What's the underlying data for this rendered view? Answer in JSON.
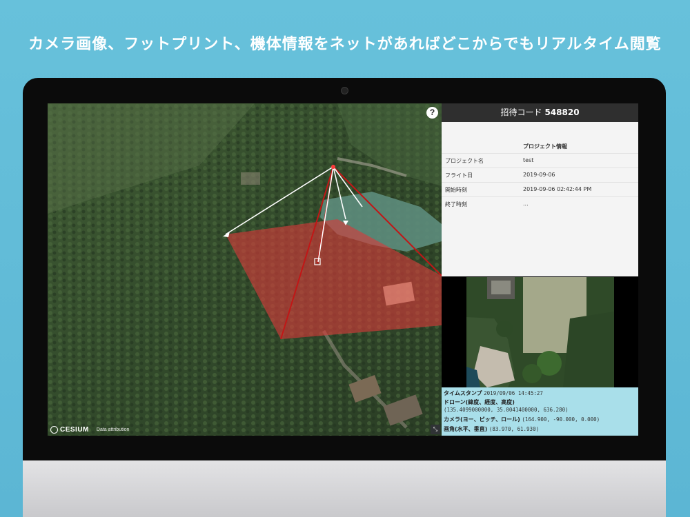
{
  "headline": "カメラ画像、フットプリント、機体情報をネットがあればどこからでもリアルタイム閲覧",
  "panel": {
    "invite_label": "招待コード",
    "invite_code": "548820",
    "info_header": "プロジェクト情報",
    "rows": [
      {
        "label": "プロジェクト名",
        "value": "test"
      },
      {
        "label": "フライト日",
        "value": "2019-09-06"
      },
      {
        "label": "開始時刻",
        "value": "2019-09-06 02:42:44 PM"
      },
      {
        "label": "終了時刻",
        "value": "..."
      }
    ]
  },
  "telemetry": {
    "timestamp_label": "タイムスタンプ",
    "timestamp_value": "2019/09/06 14:45:27",
    "drone_label": "ドローン(緯度、経度、高度)",
    "drone_value": "(135.4099000000, 35.0041400000, 636.280)",
    "camera_label": "カメラ(ヨー、ピッチ、ロール)",
    "camera_value": "(164.900, -90.000, 0.000)",
    "fov_label": "画角(水平、垂直)",
    "fov_value": "(83.970, 61.930)"
  },
  "map": {
    "help_glyph": "?",
    "logo_text": "CESIUM",
    "attribution": "Data attribution",
    "fullscreen_glyph": "⤡",
    "footprint_color": "#d93a3a"
  }
}
